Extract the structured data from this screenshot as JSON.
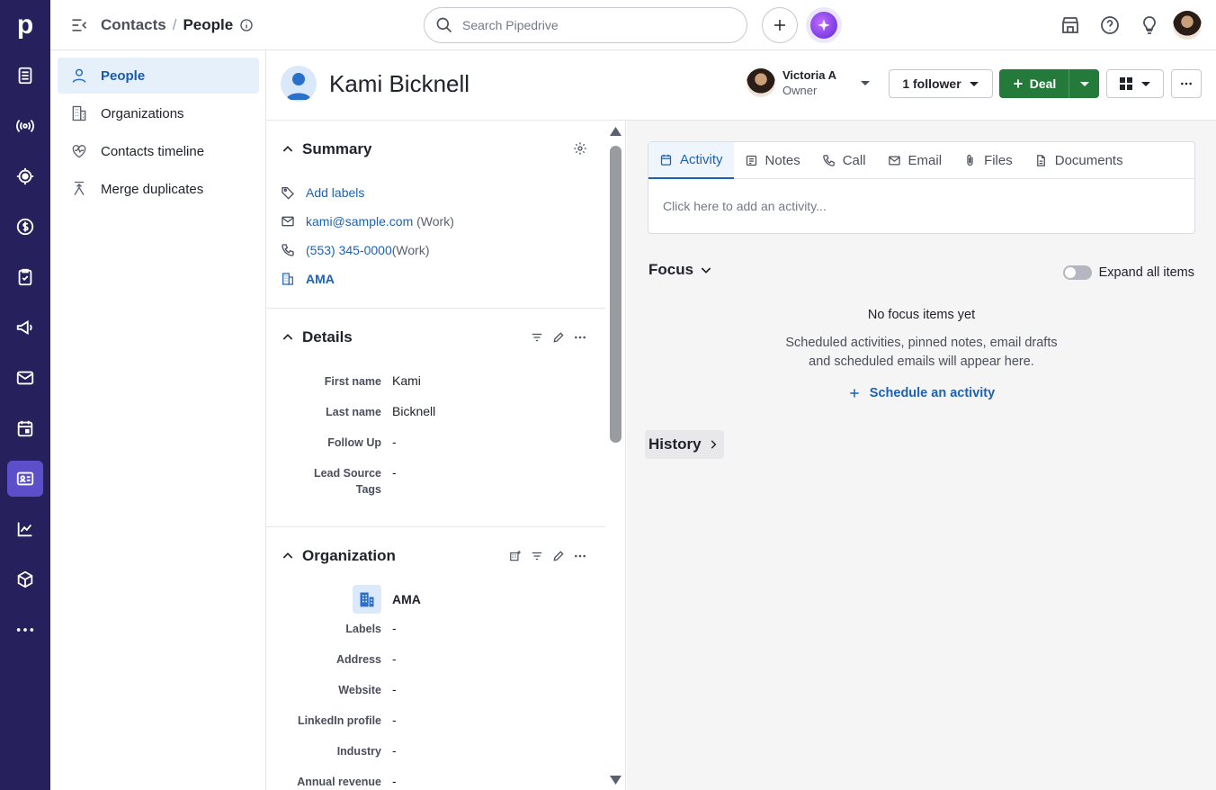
{
  "app": {
    "logo": "p"
  },
  "breadcrumb": {
    "section": "Contacts",
    "separator": "/",
    "current": "People"
  },
  "search": {
    "placeholder": "Search Pipedrive"
  },
  "subnav": {
    "items": [
      {
        "label": "People",
        "icon": "person-icon",
        "active": true
      },
      {
        "label": "Organizations",
        "icon": "building-icon",
        "active": false
      },
      {
        "label": "Contacts timeline",
        "icon": "heart-pulse-icon",
        "active": false
      },
      {
        "label": "Merge duplicates",
        "icon": "merge-icon",
        "active": false
      }
    ]
  },
  "person": {
    "name": "Kami Bicknell"
  },
  "owner": {
    "name": "Victoria A",
    "role": "Owner"
  },
  "followers": {
    "label": "1 follower"
  },
  "deal_button": {
    "label": "Deal"
  },
  "summary": {
    "title": "Summary",
    "add_labels": "Add labels",
    "email": "kami@sample.com",
    "email_type": "(Work)",
    "phone": "(553) 345-0000",
    "phone_type": "(Work)",
    "organization": "AMA"
  },
  "details": {
    "title": "Details",
    "fields": [
      {
        "label": "First name",
        "value": "Kami"
      },
      {
        "label": "Last name",
        "value": "Bicknell"
      },
      {
        "label": "Follow Up",
        "value": "-"
      },
      {
        "label": "Lead Source Tags",
        "value": "-"
      }
    ]
  },
  "organization": {
    "title": "Organization",
    "name": "AMA",
    "fields": [
      {
        "label": "Labels",
        "value": "-"
      },
      {
        "label": "Address",
        "value": "-"
      },
      {
        "label": "Website",
        "value": "-"
      },
      {
        "label": "LinkedIn profile",
        "value": "-"
      },
      {
        "label": "Industry",
        "value": "-"
      },
      {
        "label": "Annual revenue",
        "value": "-"
      }
    ]
  },
  "composer": {
    "tabs": [
      {
        "label": "Activity",
        "icon": "calendar-icon",
        "active": true
      },
      {
        "label": "Notes",
        "icon": "note-icon",
        "active": false
      },
      {
        "label": "Call",
        "icon": "phone-icon",
        "active": false
      },
      {
        "label": "Email",
        "icon": "mail-icon",
        "active": false
      },
      {
        "label": "Files",
        "icon": "paperclip-icon",
        "active": false
      },
      {
        "label": "Documents",
        "icon": "document-icon",
        "active": false
      }
    ],
    "placeholder": "Click here to add an activity..."
  },
  "focus": {
    "title": "Focus",
    "expand_label": "Expand all items",
    "empty_title": "No focus items yet",
    "empty_line1": "Scheduled activities, pinned notes, email drafts",
    "empty_line2": "and scheduled emails will appear here.",
    "cta": "Schedule an activity"
  },
  "history": {
    "title": "History"
  },
  "colors": {
    "rail": "#26215c",
    "rail_active": "#5c4fc9",
    "link": "#1a62b8",
    "deal_green": "#237a3b",
    "active_bg": "#e5f0fb"
  }
}
